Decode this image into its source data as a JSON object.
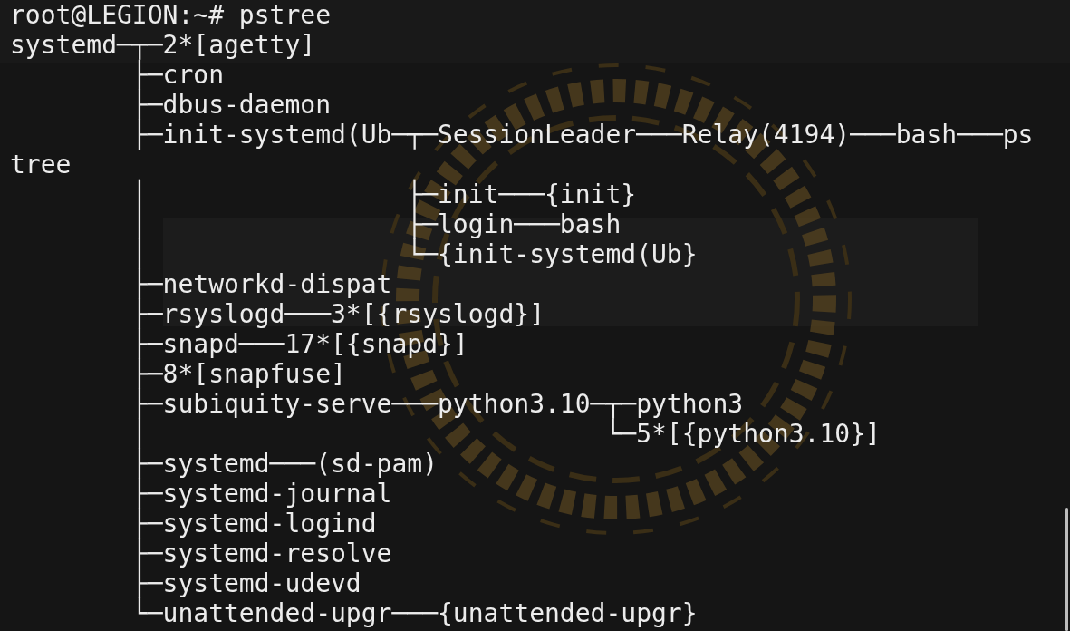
{
  "terminal": {
    "lines": [
      "root@LEGION:~# pstree",
      "systemd─┬─2*[agetty]",
      "        ├─cron",
      "        ├─dbus-daemon",
      "        ├─init-systemd(Ub─┬─SessionLeader───Relay(4194)───bash───ps",
      "tree",
      "        │                 ├─init───{init}",
      "        │                 ├─login───bash",
      "        │                 └─{init-systemd(Ub}",
      "        ├─networkd-dispat",
      "        ├─rsyslogd───3*[{rsyslogd}]",
      "        ├─snapd───17*[{snapd}]",
      "        ├─8*[snapfuse]",
      "        ├─subiquity-serve───python3.10─┬─python3",
      "        │                              └─5*[{python3.10}]",
      "        ├─systemd───(sd-pam)",
      "        ├─systemd-journal",
      "        ├─systemd-logind",
      "        ├─systemd-resolve",
      "        ├─systemd-udevd",
      "        └─unattended-upgr───{unattended-upgr}"
    ]
  }
}
